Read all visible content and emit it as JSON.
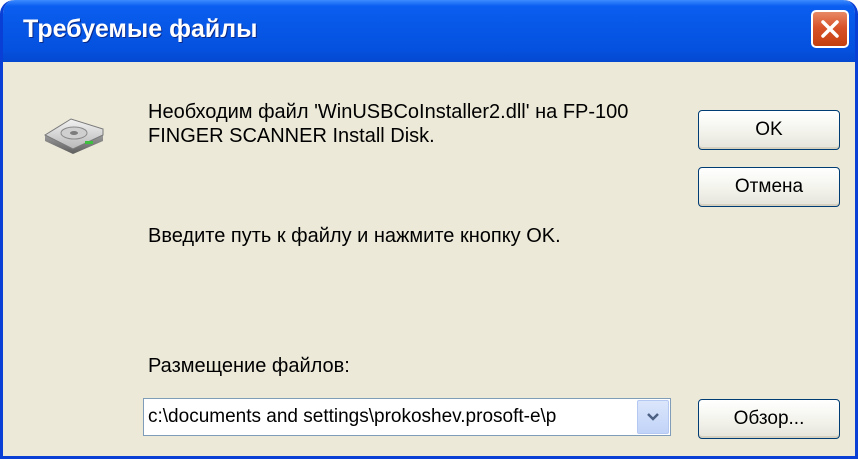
{
  "window": {
    "title": "Требуемые файлы"
  },
  "dialog": {
    "message": "Необходим файл 'WinUSBCoInstaller2.dll' на FP-100 FINGER SCANNER Install Disk.",
    "instruction": "Введите путь к файлу и нажмите кнопку OK.",
    "location_label": "Размещение файлов:",
    "location_value": "c:\\documents and settings\\prokoshev.prosoft-e\\p"
  },
  "buttons": {
    "ok_label": "OK",
    "cancel_label": "Отмена",
    "browse_label": "Обзор..."
  },
  "icons": {
    "close": "close-icon",
    "disk": "disk-drive-icon",
    "dropdown": "chevron-down-icon"
  },
  "colors": {
    "titlebar": "#0756e5",
    "window_bg": "#ece9d8",
    "close_button": "#d8522a",
    "button_border": "#003c74"
  }
}
